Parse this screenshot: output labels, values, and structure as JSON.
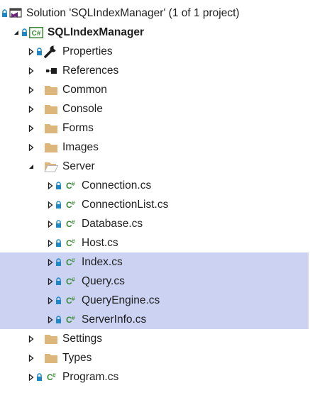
{
  "solution": {
    "label": "Solution 'SQLIndexManager' (1 of 1 project)"
  },
  "project": {
    "label": "SQLIndexManager",
    "icon_text": "C#"
  },
  "items": {
    "properties": "Properties",
    "references": "References",
    "common": "Common",
    "console": "Console",
    "forms": "Forms",
    "images": "Images",
    "server": "Server",
    "connection": "Connection.cs",
    "connectionlist": "ConnectionList.cs",
    "database": "Database.cs",
    "host": "Host.cs",
    "index": "Index.cs",
    "query": "Query.cs",
    "queryengine": "QueryEngine.cs",
    "serverinfo": "ServerInfo.cs",
    "settings": "Settings",
    "types": "Types",
    "program": "Program.cs"
  },
  "cs_icon_text": "C",
  "cs_icon_sup": "#",
  "colors": {
    "selection": "#ccd3f2",
    "folder": "#dcb67a",
    "csharp": "#388a34",
    "lock": "#1e88c7"
  }
}
